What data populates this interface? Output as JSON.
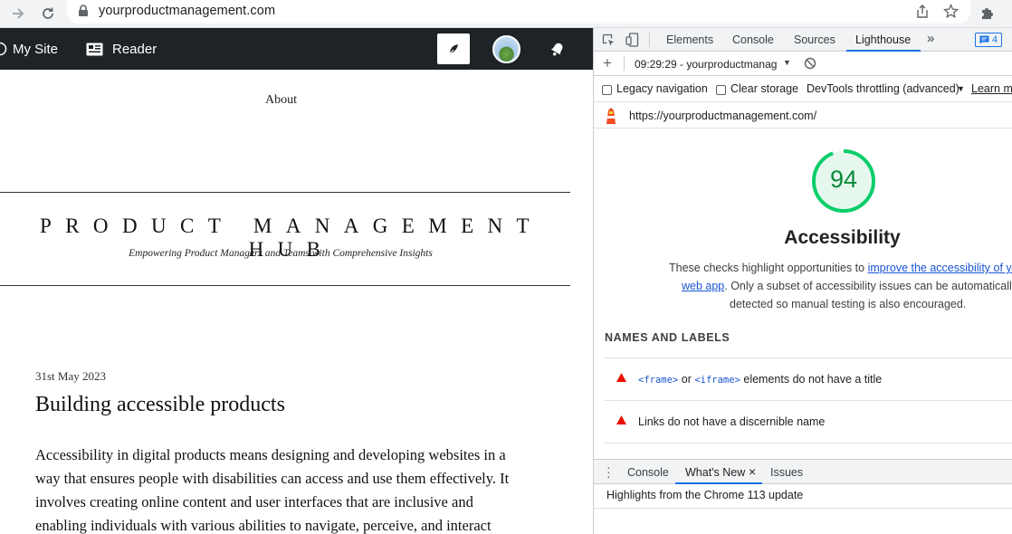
{
  "browser": {
    "url": "yourproductmanagement.com"
  },
  "wp_admin_bar": {
    "my_site": "My Site",
    "reader": "Reader"
  },
  "site": {
    "nav_about": "About",
    "title": "PRODUCT MANAGEMENT HUB",
    "tagline": "Empowering Product Managers and Teams with Comprehensive Insights",
    "post": {
      "date": "31st May 2023",
      "title": "Building accessible products",
      "body_lines": [
        "Accessibility in digital products means designing and developing websites in a",
        "way that ensures people with disabilities can access and use them effectively. It",
        "involves creating online content and user interfaces that are inclusive and",
        "enabling individuals with various abilities to navigate, perceive, and interact"
      ]
    }
  },
  "devtools": {
    "tabs": [
      "Elements",
      "Console",
      "Sources",
      "Lighthouse"
    ],
    "active_tab": "Lighthouse",
    "more_tabs": "»",
    "issues_count": "4",
    "report_select": "09:29:29 - yourproductmanag",
    "legacy_navigation": "Legacy navigation",
    "clear_storage": "Clear storage",
    "throttling": "DevTools throttling (advanced)",
    "learn_more": "Learn mo",
    "audited_url": "https://yourproductmanagement.com/",
    "score": "94",
    "score_fraction": 0.94,
    "score_color": "#0cce6b",
    "category": "Accessibility",
    "desc_line1_pre": "These checks highlight opportunities to ",
    "desc_link_1": "improve the accessibility of you",
    "desc_link_2": "web app",
    "desc_line2_post": ". Only a subset of accessibility issues can be automatically",
    "desc_line3": "detected so manual testing is also encouraged.",
    "group_title": "NAMES AND LABELS",
    "audit1_code1": "<frame>",
    "audit1_mid": " or ",
    "audit1_code2": "<iframe>",
    "audit1_post": " elements do not have a title",
    "audit2": "Links do not have a discernible name",
    "fail_color": "#eb0f00",
    "drawer": {
      "tabs": [
        "Console",
        "What's New",
        "Issues"
      ],
      "active_tab": "What's New",
      "close": "×",
      "headline": "Highlights from the Chrome 113 update"
    }
  }
}
